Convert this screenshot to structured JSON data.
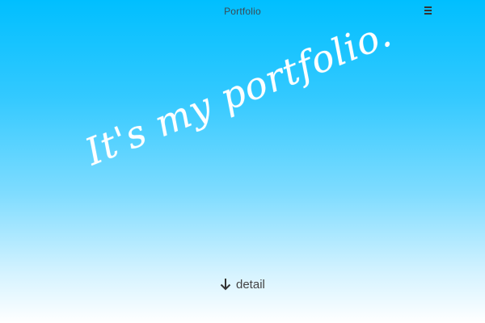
{
  "header": {
    "title": "Portfolio",
    "menu_icon": "hamburger-menu-icon"
  },
  "hero": {
    "text": "It's my portfolio."
  },
  "detail": {
    "label": "detail",
    "icon": "arrow-down-icon"
  },
  "colors": {
    "gradient_top": "#00bfff",
    "gradient_bottom": "#ffffff",
    "hero_text": "#ffffff",
    "detail_text": "#444444"
  }
}
